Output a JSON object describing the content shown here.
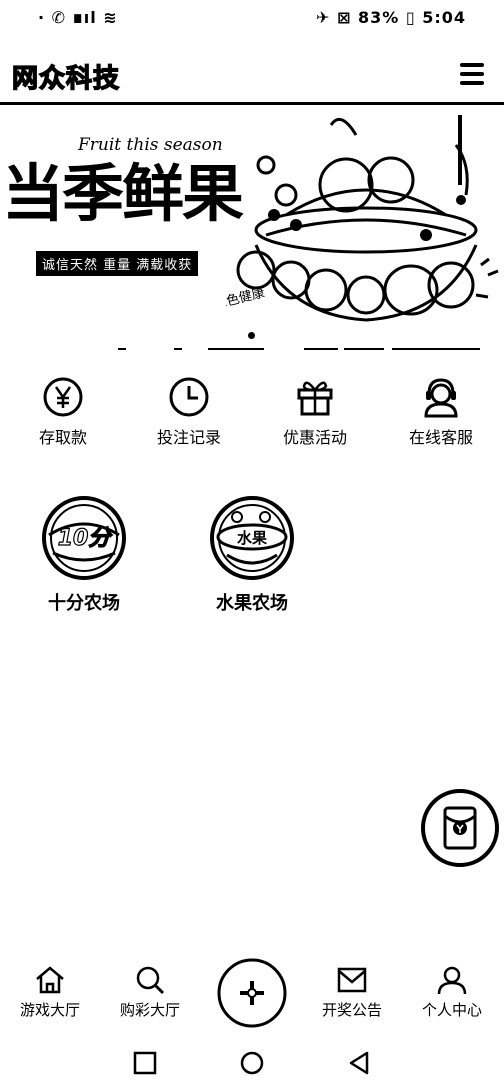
{
  "status_bar": {
    "left_text": "· ✆ ∎ıl ≋",
    "right_text": "✈ ⊠ 83% ▯ 5:04"
  },
  "header": {
    "brand": "网众科技",
    "menu_icon": "hamburger-menu-icon"
  },
  "banner": {
    "script_text": "Fruit this season",
    "title": "当季鲜果",
    "tag": "诚信天然 重量 满载收获",
    "slide_index": 1
  },
  "quick_menu": [
    {
      "label": "存取款",
      "icon": "yen-circle-icon"
    },
    {
      "label": "投注记录",
      "icon": "clock-icon"
    },
    {
      "label": "优惠活动",
      "icon": "gift-icon"
    },
    {
      "label": "在线客服",
      "icon": "headset-icon"
    }
  ],
  "games": [
    {
      "name": "十分农场",
      "logo_text": "10分",
      "icon": "ten-minute-farm-logo"
    },
    {
      "name": "水果农场",
      "logo_text": "水果",
      "icon": "fruit-farm-logo"
    }
  ],
  "floating_button": {
    "icon": "red-envelope-icon"
  },
  "tabbar": [
    {
      "label": "游戏大厅",
      "icon": "home-icon"
    },
    {
      "label": "购彩大厅",
      "icon": "search-icon"
    },
    {
      "label": "",
      "icon": "plus-center-icon"
    },
    {
      "label": "开奖公告",
      "icon": "mail-icon"
    },
    {
      "label": "个人中心",
      "icon": "user-icon"
    }
  ],
  "colors": {
    "foreground": "#000000",
    "background": "#ffffff"
  }
}
